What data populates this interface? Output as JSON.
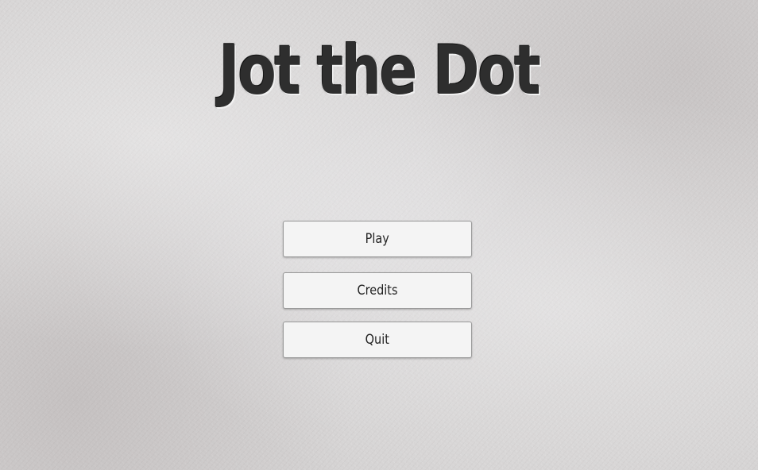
{
  "game": {
    "title": "Jot the Dot"
  },
  "menu": {
    "buttons": [
      {
        "label": "Play"
      },
      {
        "label": "Credits"
      },
      {
        "label": "Quit"
      }
    ]
  },
  "colors": {
    "background": "#d4d2d2",
    "button_background": "#f4f4f4",
    "button_border": "#9a9a9a",
    "title_text": "#2e2e2e"
  }
}
